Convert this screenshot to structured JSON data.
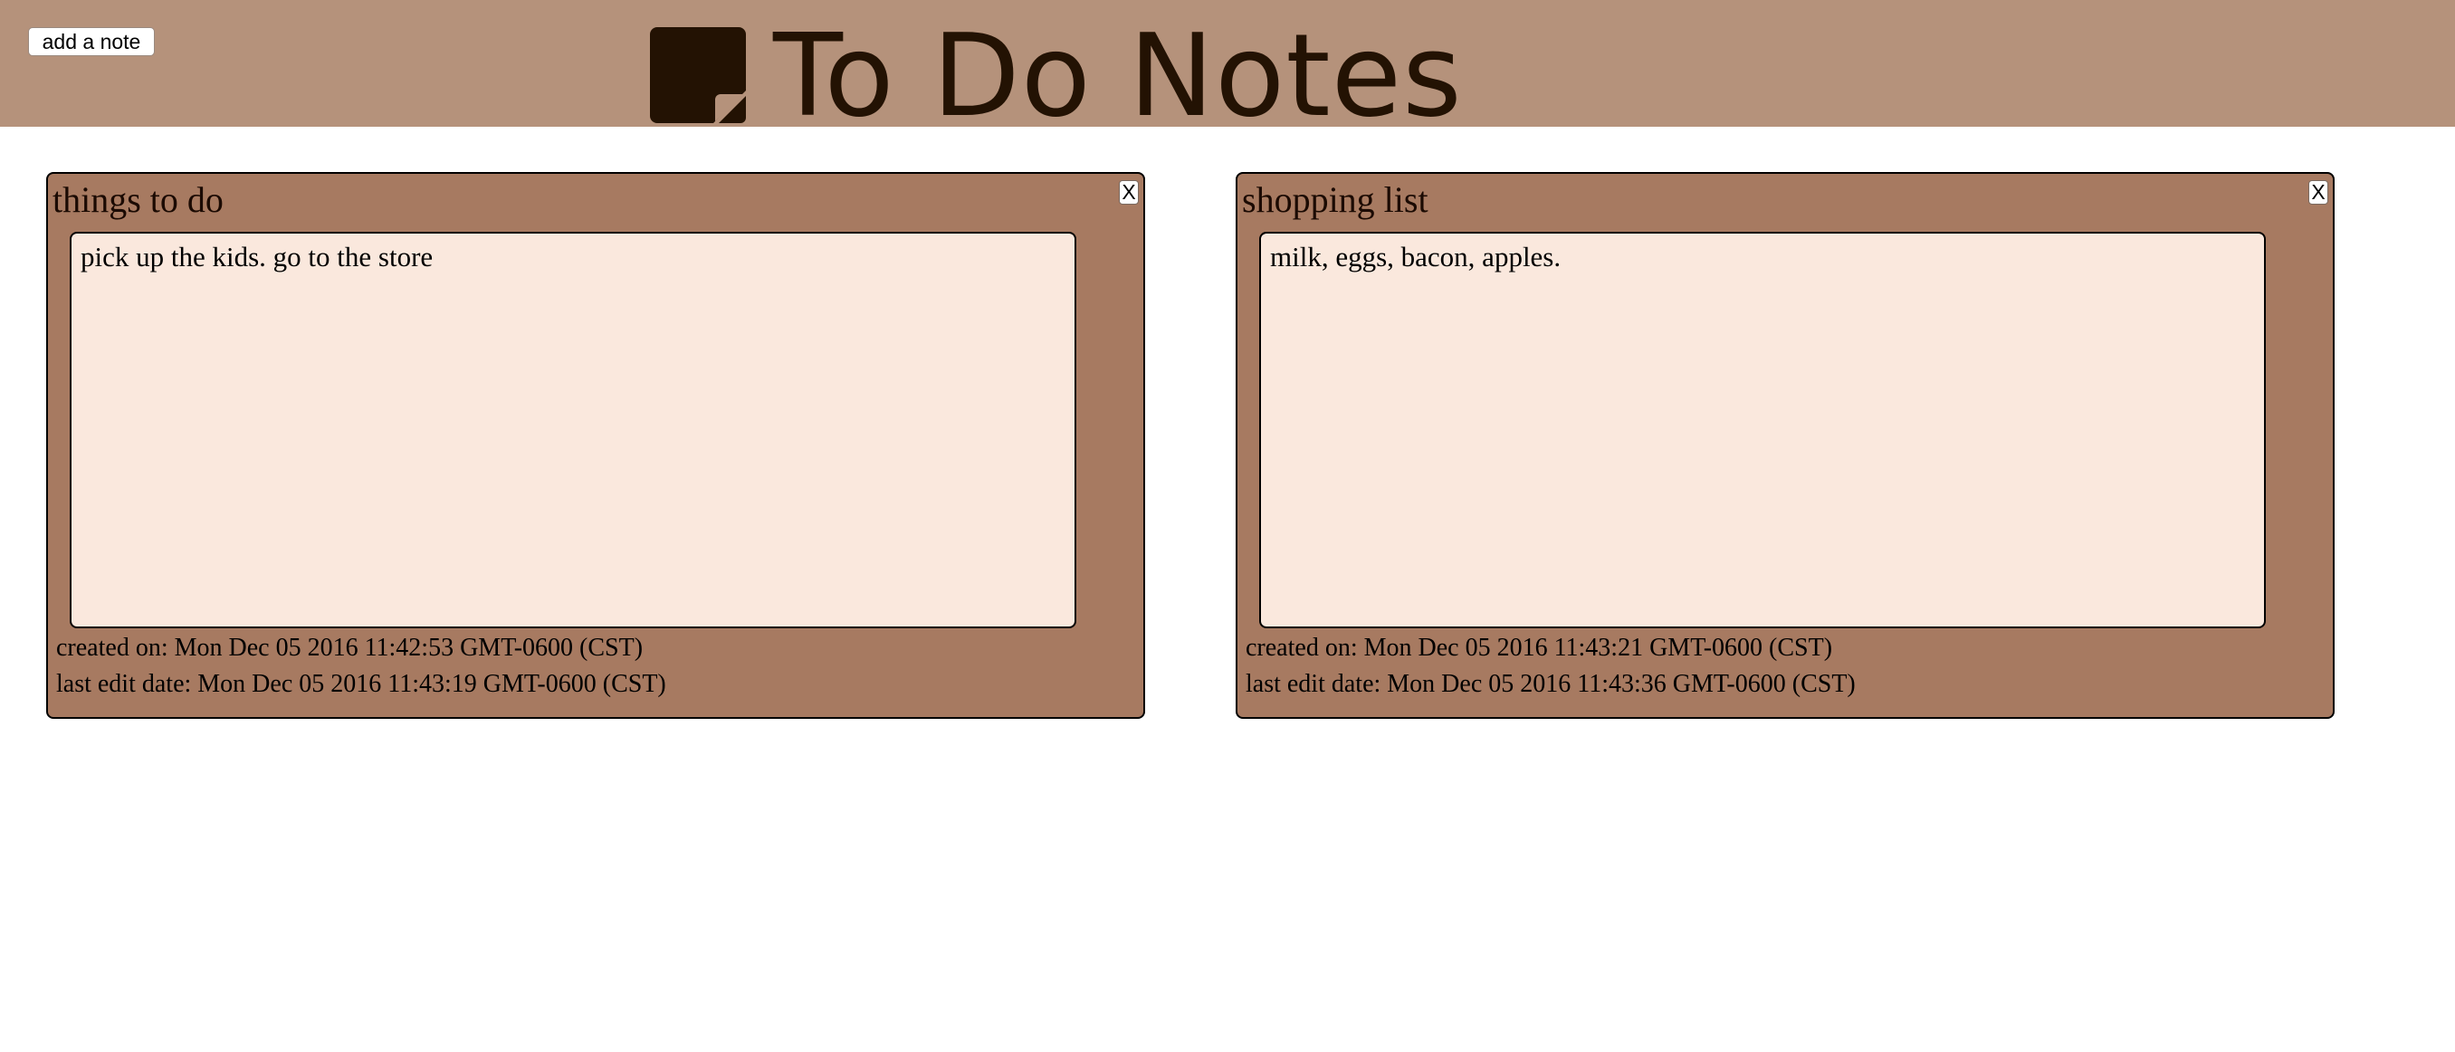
{
  "header": {
    "add_note_label": "add a note",
    "title": "To Do Notes",
    "logo_icon": "sticky-note-icon",
    "background_color": "#b5927b",
    "title_color": "#231203"
  },
  "notes": [
    {
      "title": "things to do",
      "close_label": "X",
      "body": "pick up the kids. go to the store",
      "created": "created on: Mon Dec 05 2016 11:42:53 GMT-0600 (CST)",
      "edited": "last edit date: Mon Dec 05 2016 11:43:19 GMT-0600 (CST)"
    },
    {
      "title": "shopping list",
      "close_label": "X",
      "body": "milk, eggs, bacon, apples.",
      "created": "created on: Mon Dec 05 2016 11:43:21 GMT-0600 (CST)",
      "edited": "last edit date: Mon Dec 05 2016 11:43:36 GMT-0600 (CST)"
    }
  ],
  "colors": {
    "note_background": "#a77a61",
    "note_body_background": "#fae8dd"
  }
}
